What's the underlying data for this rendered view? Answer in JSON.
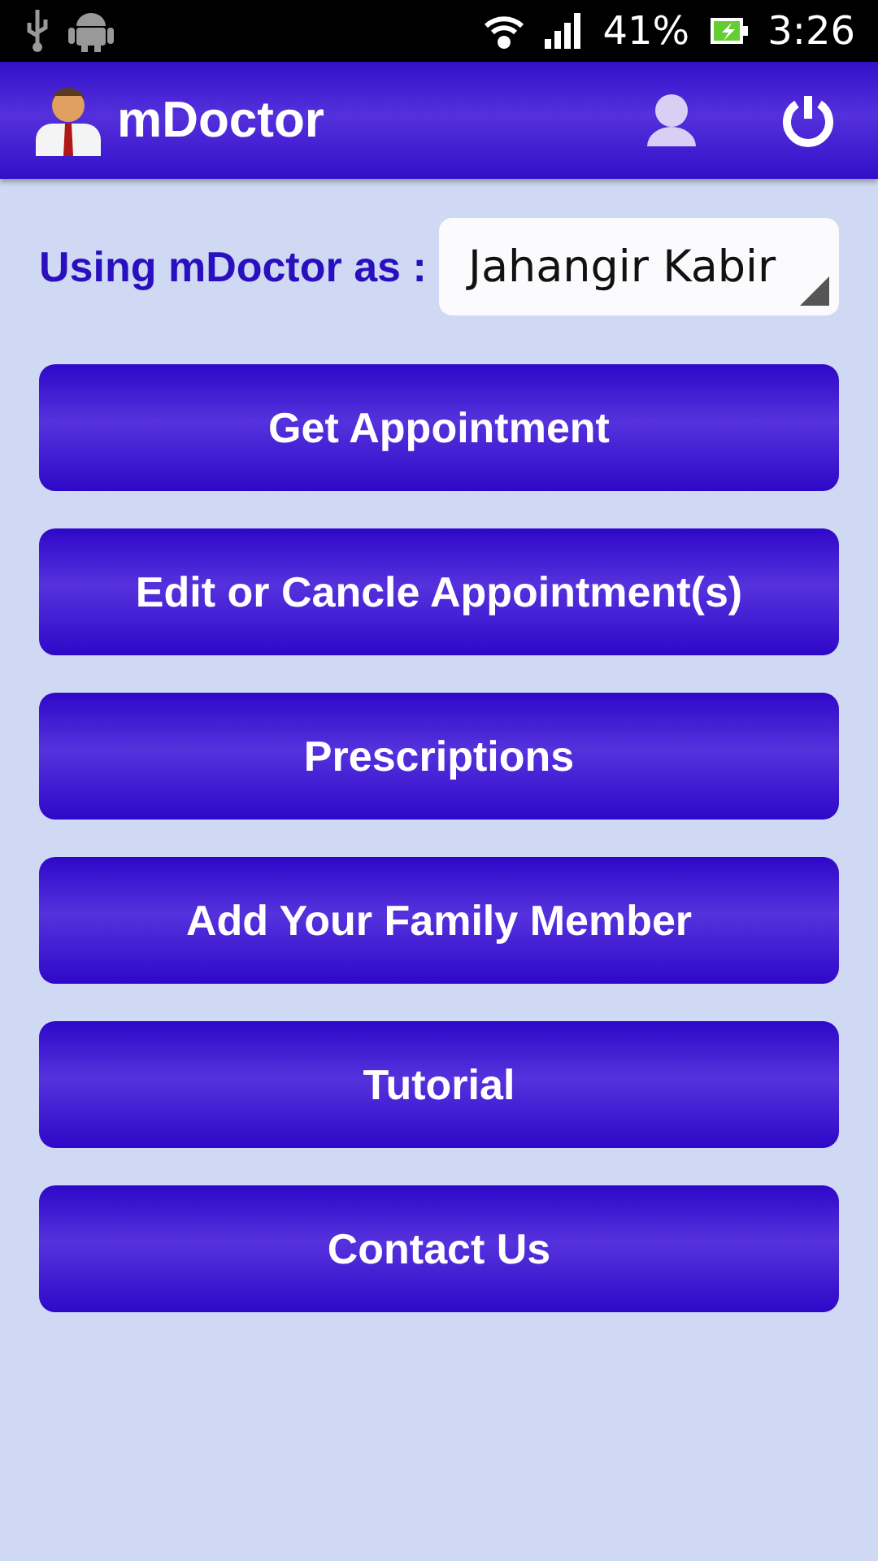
{
  "status_bar": {
    "battery_percent": "41%",
    "time": "3:26"
  },
  "app_bar": {
    "title": "mDoctor"
  },
  "user_select": {
    "label": "Using mDoctor as :",
    "value": "Jahangir Kabir"
  },
  "menu_buttons": [
    {
      "label": "Get Appointment"
    },
    {
      "label": "Edit or Cancle Appointment(s)"
    },
    {
      "label": "Prescriptions"
    },
    {
      "label": "Add Your Family Member"
    },
    {
      "label": "Tutorial"
    },
    {
      "label": "Contact Us"
    }
  ]
}
